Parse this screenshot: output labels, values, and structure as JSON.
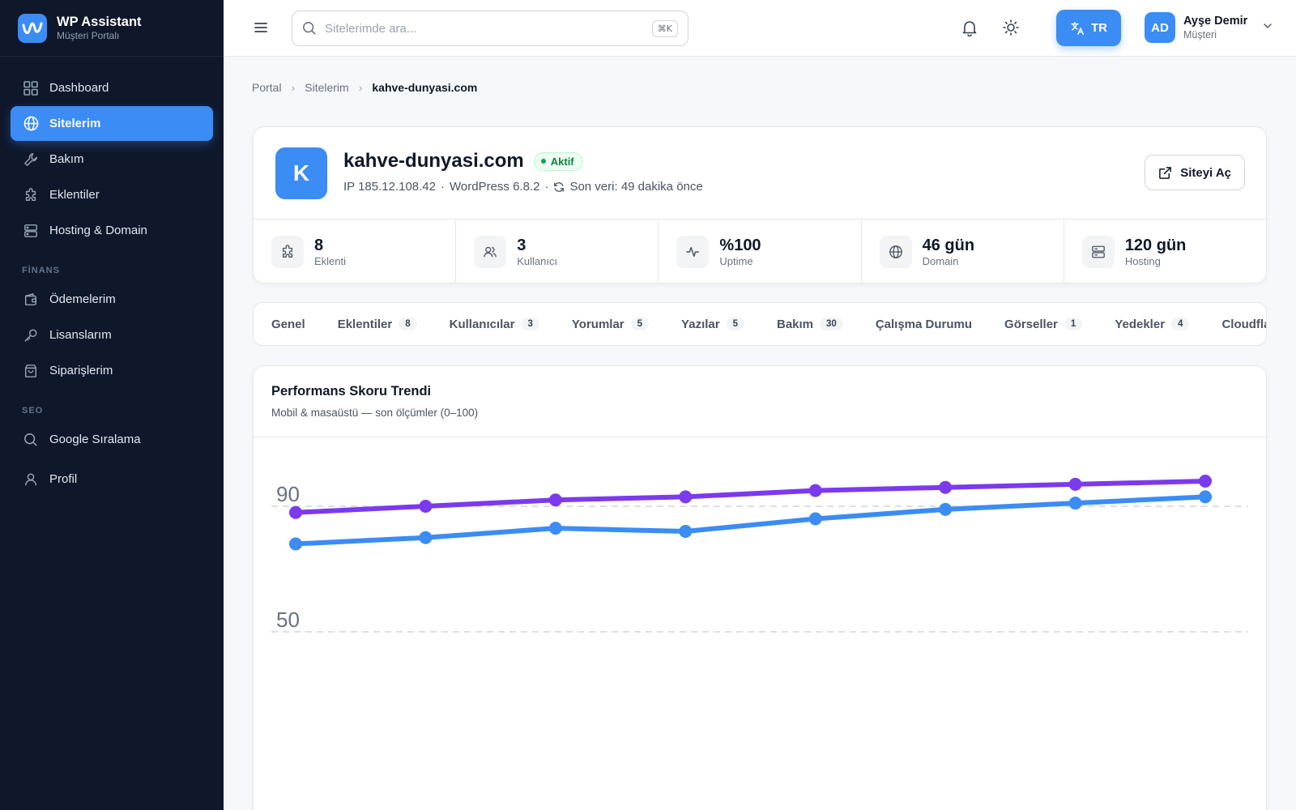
{
  "brand": {
    "title": "WP Assistant",
    "subtitle": "Müşteri Portalı",
    "color": "#3b8cf5"
  },
  "sidebar": {
    "items": [
      {
        "label": "Dashboard",
        "icon": "dashboard-icon"
      },
      {
        "label": "Sitelerim",
        "icon": "globe-icon",
        "active": true
      },
      {
        "label": "Bakım",
        "icon": "wrench-icon"
      },
      {
        "label": "Eklentiler",
        "icon": "puzzle-icon"
      },
      {
        "label": "Hosting & Domain",
        "icon": "server-icon"
      }
    ],
    "finance_title": "FİNANS",
    "finance_items": [
      {
        "label": "Ödemelerim",
        "icon": "wallet-icon"
      },
      {
        "label": "Lisanslarım",
        "icon": "key-icon"
      },
      {
        "label": "Siparişlerim",
        "icon": "shopping-bag-icon"
      }
    ],
    "seo_title": "SEO",
    "seo_items": [
      {
        "label": "Google Sıralama",
        "icon": "search-icon"
      },
      {
        "label": "Profil",
        "icon": "user-icon"
      }
    ]
  },
  "topbar": {
    "search_placeholder": "Sitelerimde ara...",
    "search_shortcut": "⌘K",
    "lang_label": "TR",
    "user": {
      "initials": "AD",
      "name": "Ayşe Demir",
      "role": "Müşteri"
    }
  },
  "breadcrumb": [
    "Portal",
    "Sitelerim",
    "kahve-dunyasi.com"
  ],
  "site": {
    "initial": "K",
    "domain": "kahve-dunyasi.com",
    "status": "Aktif",
    "ip": "IP 185.12.108.42",
    "wordpress": "WordPress 6.8.2",
    "last_data": "Son veri: 49 dakika önce",
    "open_button": "Siteyi Aç"
  },
  "stats": [
    {
      "value": "8",
      "label": "Eklenti",
      "icon": "puzzle-icon"
    },
    {
      "value": "3",
      "label": "Kullanıcı",
      "icon": "users-icon"
    },
    {
      "value": "%100",
      "label": "Uptime",
      "icon": "activity-icon"
    },
    {
      "value": "46 gün",
      "label": "Domain",
      "icon": "globe-icon"
    },
    {
      "value": "120 gün",
      "label": "Hosting",
      "icon": "server-icon"
    }
  ],
  "tabs": [
    {
      "label": "Genel",
      "count": ""
    },
    {
      "label": "Eklentiler",
      "count": "8"
    },
    {
      "label": "Kullanıcılar",
      "count": "3"
    },
    {
      "label": "Yorumlar",
      "count": "5"
    },
    {
      "label": "Yazılar",
      "count": "5"
    },
    {
      "label": "Bakım",
      "count": "30"
    },
    {
      "label": "Çalışma Durumu",
      "count": ""
    },
    {
      "label": "Görseller",
      "count": "1"
    },
    {
      "label": "Yedekler",
      "count": "4"
    },
    {
      "label": "Cloudflare",
      "count": ""
    }
  ],
  "chart_card": {
    "title": "Performans Skoru Trendi",
    "subtitle": "Mobil & masaüstü — son ölçümler (0–100)"
  },
  "chart_data": {
    "type": "line",
    "ylim": [
      0,
      100
    ],
    "yticks": [
      90,
      50
    ],
    "grid": true,
    "x": [
      1,
      2,
      3,
      4,
      5,
      6,
      7,
      8
    ],
    "series": [
      {
        "color": "#7c3aed",
        "values": [
          88,
          90,
          92,
          93,
          95,
          96,
          97,
          98
        ]
      },
      {
        "color": "#3b8cf5",
        "values": [
          78,
          80,
          83,
          82,
          86,
          89,
          91,
          93
        ]
      }
    ]
  }
}
